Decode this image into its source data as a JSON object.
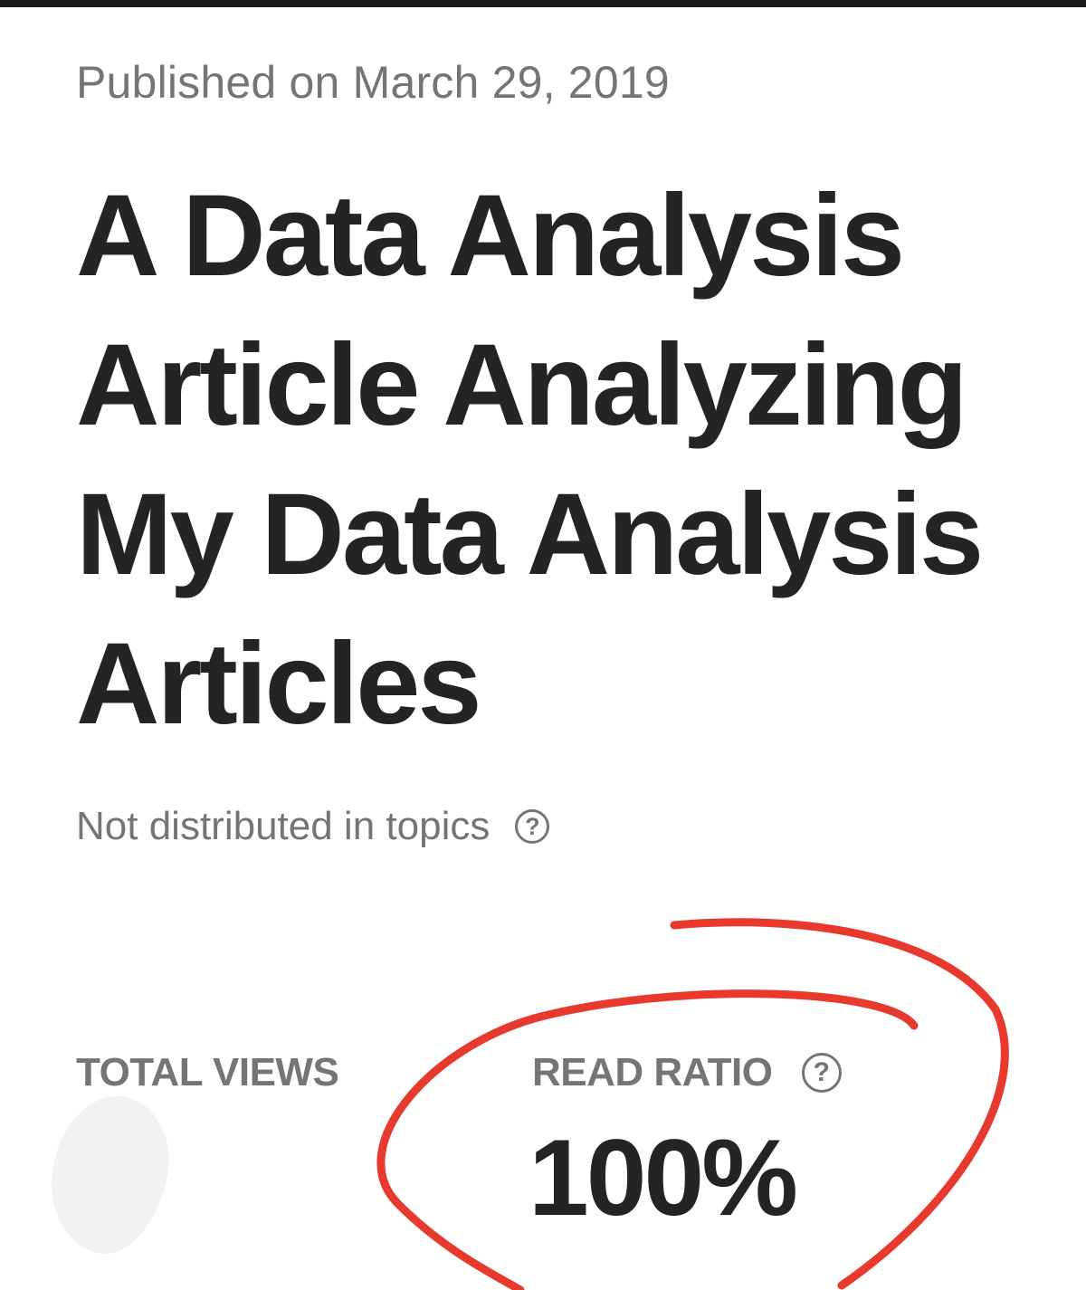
{
  "article": {
    "published": "Published on March 29, 2019",
    "title": "A Data Analysis Article Analyzing My Data Analysis Articles",
    "distribution": "Not distributed in topics"
  },
  "stats": {
    "total_views_label": "TOTAL VIEWS",
    "read_ratio_label": "READ RATIO",
    "read_ratio_value": "100%"
  },
  "icons": {
    "help": "help-circle-icon",
    "help_glyph": "?"
  },
  "colors": {
    "text_primary": "#242424",
    "text_secondary": "#757575",
    "annotation": "#e8392e"
  }
}
